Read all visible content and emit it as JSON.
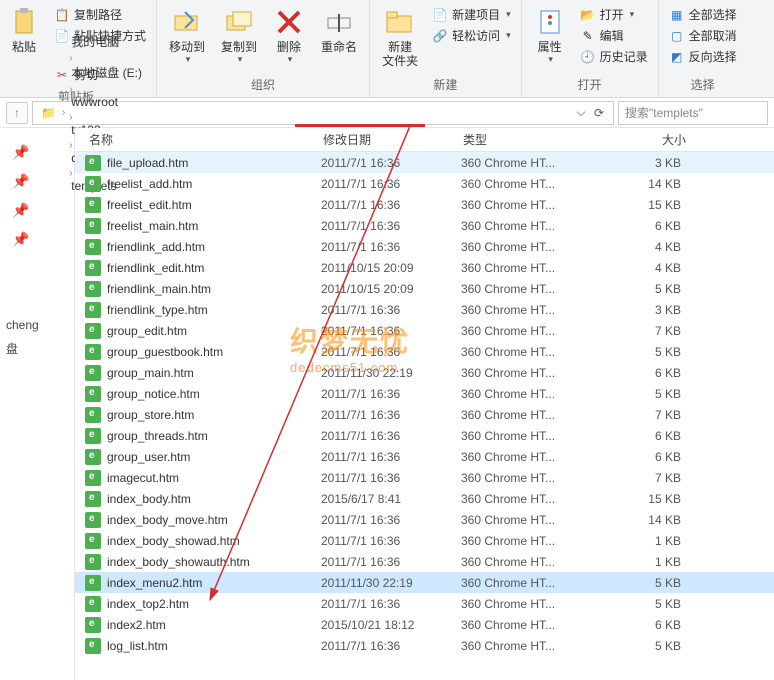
{
  "ribbon": {
    "clipboard": {
      "label": "剪贴板",
      "paste": "粘贴",
      "copy_path": "复制路径",
      "paste_shortcut": "粘贴快捷方式",
      "cut": "剪切"
    },
    "organize": {
      "label": "组织",
      "move_to": "移动到",
      "copy_to": "复制到",
      "delete": "删除",
      "rename": "重命名"
    },
    "new": {
      "label": "新建",
      "new_folder": "新建\n文件夹",
      "new_item": "新建项目",
      "easy_access": "轻松访问"
    },
    "open": {
      "label": "打开",
      "properties": "属性",
      "open": "打开",
      "edit": "编辑",
      "history": "历史记录"
    },
    "select": {
      "label": "选择",
      "select_all": "全部选择",
      "select_none": "全部取消",
      "invert": "反向选择"
    }
  },
  "breadcrumb": {
    "items": [
      "我的电脑",
      "本地磁盘 (E:)",
      "wwwroot",
      "tx123",
      "dede",
      "templets"
    ],
    "search_placeholder": "搜索\"templets\""
  },
  "left": {
    "item1": "cheng",
    "item2": "盘"
  },
  "columns": {
    "name": "名称",
    "date": "修改日期",
    "type": "类型",
    "size": "大小"
  },
  "file_type": "360 Chrome HT...",
  "files": [
    {
      "name": "file_upload.htm",
      "date": "2011/7/1 16:36",
      "size": "3 KB",
      "sel": "hov"
    },
    {
      "name": "freelist_add.htm",
      "date": "2011/7/1 16:36",
      "size": "14 KB"
    },
    {
      "name": "freelist_edit.htm",
      "date": "2011/7/1 16:36",
      "size": "15 KB"
    },
    {
      "name": "freelist_main.htm",
      "date": "2011/7/1 16:36",
      "size": "6 KB"
    },
    {
      "name": "friendlink_add.htm",
      "date": "2011/7/1 16:36",
      "size": "4 KB"
    },
    {
      "name": "friendlink_edit.htm",
      "date": "2011/10/15 20:09",
      "size": "4 KB"
    },
    {
      "name": "friendlink_main.htm",
      "date": "2011/10/15 20:09",
      "size": "5 KB"
    },
    {
      "name": "friendlink_type.htm",
      "date": "2011/7/1 16:36",
      "size": "3 KB"
    },
    {
      "name": "group_edit.htm",
      "date": "2011/7/1 16:36",
      "size": "7 KB"
    },
    {
      "name": "group_guestbook.htm",
      "date": "2011/7/1 16:36",
      "size": "5 KB"
    },
    {
      "name": "group_main.htm",
      "date": "2011/11/30 22:19",
      "size": "6 KB"
    },
    {
      "name": "group_notice.htm",
      "date": "2011/7/1 16:36",
      "size": "5 KB"
    },
    {
      "name": "group_store.htm",
      "date": "2011/7/1 16:36",
      "size": "7 KB"
    },
    {
      "name": "group_threads.htm",
      "date": "2011/7/1 16:36",
      "size": "6 KB"
    },
    {
      "name": "group_user.htm",
      "date": "2011/7/1 16:36",
      "size": "6 KB"
    },
    {
      "name": "imagecut.htm",
      "date": "2011/7/1 16:36",
      "size": "7 KB"
    },
    {
      "name": "index_body.htm",
      "date": "2015/6/17 8:41",
      "size": "15 KB"
    },
    {
      "name": "index_body_move.htm",
      "date": "2011/7/1 16:36",
      "size": "14 KB"
    },
    {
      "name": "index_body_showad.htm",
      "date": "2011/7/1 16:36",
      "size": "1 KB"
    },
    {
      "name": "index_body_showauth.htm",
      "date": "2011/7/1 16:36",
      "size": "1 KB"
    },
    {
      "name": "index_menu2.htm",
      "date": "2011/11/30 22:19",
      "size": "5 KB",
      "sel": "sel"
    },
    {
      "name": "index_top2.htm",
      "date": "2011/7/1 16:36",
      "size": "5 KB"
    },
    {
      "name": "index2.htm",
      "date": "2015/10/21 18:12",
      "size": "6 KB"
    },
    {
      "name": "log_list.htm",
      "date": "2011/7/1 16:36",
      "size": "5 KB"
    }
  ],
  "watermark": {
    "line1": "织梦无忧",
    "line2": "dedecms51.com"
  }
}
